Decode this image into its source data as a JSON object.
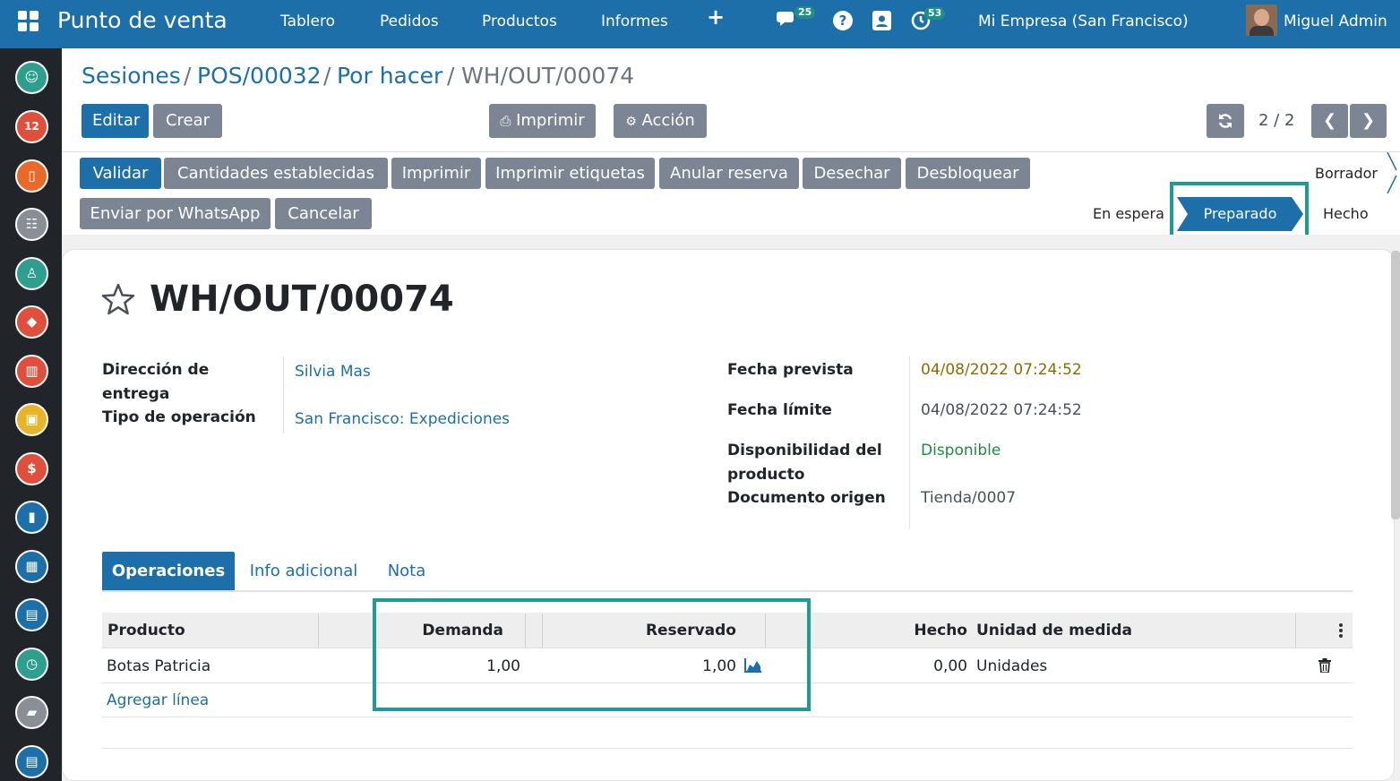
{
  "topbar": {
    "app_title": "Punto de venta",
    "menus": [
      "Tablero",
      "Pedidos",
      "Productos",
      "Informes"
    ],
    "add_symbol": "+",
    "chat_badge": "25",
    "activity_badge": "53",
    "company": "Mi Empresa (San Francisco)",
    "user": "Miguel Admin"
  },
  "breadcrumb": {
    "items": [
      "Sesiones",
      "POS/00032",
      "Por hacer"
    ],
    "current": "WH/OUT/00074",
    "separator": "/"
  },
  "control_panel": {
    "edit_label": "Editar",
    "create_label": "Crear",
    "print_label": "Imprimir",
    "action_label": "Acción",
    "pager_value": "2 / 2"
  },
  "statusbar": {
    "buttons": [
      "Validar",
      "Cantidades establecidas",
      "Imprimir",
      "Imprimir etiquetas",
      "Anular reserva",
      "Desechar",
      "Desbloquear",
      "Enviar por WhatsApp",
      "Cancelar"
    ],
    "states": [
      "Borrador",
      "En espera",
      "Preparado",
      "Hecho"
    ],
    "active_state": "Preparado"
  },
  "record": {
    "title": "WH/OUT/00074",
    "left_fields": {
      "delivery_address_label": "Dirección de entrega",
      "delivery_address_value": "Silvia Mas",
      "operation_type_label": "Tipo de operación",
      "operation_type_value": "San Francisco: Expediciones"
    },
    "right_fields": {
      "scheduled_date_label": "Fecha prevista",
      "scheduled_date_value": "04/08/2022 07:24:52",
      "deadline_label": "Fecha límite",
      "deadline_value": "04/08/2022 07:24:52",
      "availability_label": "Disponibilidad del producto",
      "availability_value": "Disponible",
      "origin_label": "Documento origen",
      "origin_value": "Tienda/0007"
    }
  },
  "tabs": [
    "Operaciones",
    "Info adicional",
    "Nota"
  ],
  "operations_table": {
    "headers": [
      "Producto",
      "Demanda",
      "Reservado",
      "Hecho",
      "Unidad de medida"
    ],
    "rows": [
      {
        "product": "Botas Patricia",
        "demand": "1,00",
        "reserved": "1,00",
        "done": "0,00",
        "uom": "Unidades"
      }
    ],
    "add_line": "Agregar línea"
  },
  "colors": {
    "brand": "#1c6fa8",
    "highlight": "#1e9c93",
    "secondary_button": "#7c8593",
    "sidebar": "#212529"
  }
}
